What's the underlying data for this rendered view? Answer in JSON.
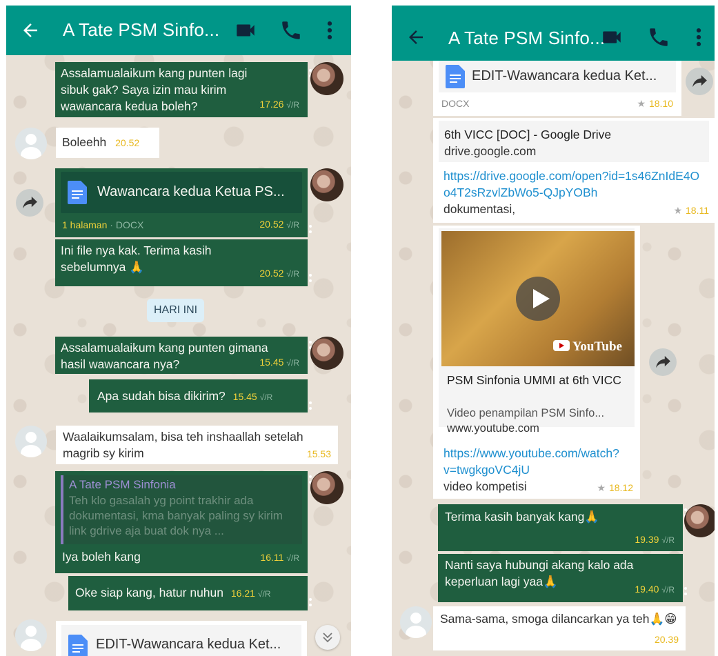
{
  "left": {
    "title": "A Tate PSM Sinfo...",
    "messages": {
      "m1": {
        "text": "Assalamualaikum kang punten lagi sibuk gak? Saya izin mau kirim wawancara kedua boleh?",
        "time": "17.26",
        "status": "√/R"
      },
      "m2": {
        "text": "Boleehh",
        "time": "20.52"
      },
      "m3": {
        "doc_name": "Wawancara kedua Ketua PS...",
        "doc_meta": "1 halaman",
        "doc_type": "· DOCX",
        "time": "20.52",
        "status": "√/R"
      },
      "m4": {
        "text": "Ini file nya kak. Terima kasih sebelumnya 🙏",
        "time": "20.52",
        "status": "√/R"
      },
      "day": "HARI INI",
      "m5": {
        "text": "Assalamualaikum kang punten gimana hasil wawancara nya?",
        "time": "15.45",
        "status": "√/R"
      },
      "m6": {
        "text": "Apa sudah bisa dikirim?",
        "time": "15.45",
        "status": "√/R"
      },
      "m7": {
        "text": "Waalaikumsalam, bisa teh inshaallah setelah magrib sy kirim",
        "time": "15.53"
      },
      "m8": {
        "quote_author": "A Tate PSM Sinfonia",
        "quote_text": "Teh klo gasalah yg point trakhir ada dokumentasi, kma banyak paling sy kirim link gdrive aja buat dok nya ...",
        "text": "Iya boleh kang",
        "time": "16.11",
        "status": "√/R"
      },
      "m9": {
        "text": "Oke siap kang, hatur nuhun",
        "time": "16.21",
        "status": "√/R"
      },
      "m10": {
        "doc_name": "EDIT-Wawancara kedua Ket..."
      }
    }
  },
  "right": {
    "title": "A Tate PSM Sinfo...",
    "messages": {
      "r1": {
        "doc_name": "EDIT-Wawancara kedua Ket...",
        "doc_type": "DOCX",
        "time": "18.10"
      },
      "r2": {
        "preview_title": "6th VICC [DOC] - Google Drive",
        "preview_domain": "drive.google.com",
        "url": "https://drive.google.com/open?id=1s46ZnIdE4Oo4T2sRzvlZbWo5-QJpYOBh",
        "caption": "dokumentasi,",
        "time": "18.11"
      },
      "r3": {
        "badge": "YouTube",
        "preview_title": "PSM Sinfonia UMMI at 6th VICC",
        "preview_desc": "Video penampilan PSM Sinfo...",
        "preview_domain": "www.youtube.com",
        "url": "https://www.youtube.com/watch?v=twgkgoVC4jU",
        "caption": "video kompetisi",
        "time": "18.12"
      },
      "r4": {
        "text": "Terima kasih banyak kang🙏",
        "time": "19.39",
        "status": "√/R"
      },
      "r5": {
        "text": "Nanti saya hubungi akang kalo ada keperluan lagi yaa🙏",
        "time": "19.40",
        "status": "√/R"
      },
      "r6": {
        "text": "Sama-sama, smoga dilancarkan ya teh🙏😁",
        "time": "20.39"
      }
    }
  },
  "colors": {
    "appbar": "#009688",
    "outgoing": "#1f5e3f",
    "incoming": "#ffffff",
    "time_outgoing": "#f1d23a",
    "link": "#1e8fcf"
  },
  "icons": [
    "back-arrow-icon",
    "video-call-icon",
    "phone-icon",
    "more-vert-icon",
    "forward-icon",
    "doc-icon",
    "play-icon",
    "scroll-down-icon",
    "star-icon"
  ]
}
